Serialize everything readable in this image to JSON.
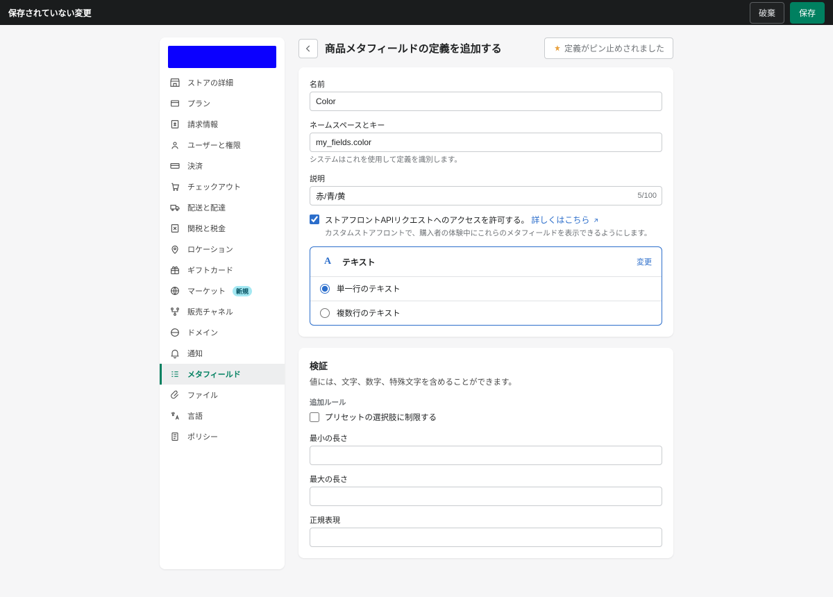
{
  "topbar": {
    "title": "保存されていない変更",
    "discard": "破棄",
    "save": "保存"
  },
  "sidebar": {
    "items": [
      {
        "label": "ストアの詳細"
      },
      {
        "label": "プラン"
      },
      {
        "label": "請求情報"
      },
      {
        "label": "ユーザーと権限"
      },
      {
        "label": "決済"
      },
      {
        "label": "チェックアウト"
      },
      {
        "label": "配送と配達"
      },
      {
        "label": "関税と税金"
      },
      {
        "label": "ロケーション"
      },
      {
        "label": "ギフトカード"
      },
      {
        "label": "マーケット",
        "badge": "新規"
      },
      {
        "label": "販売チャネル"
      },
      {
        "label": "ドメイン"
      },
      {
        "label": "通知"
      },
      {
        "label": "メタフィールド",
        "active": true
      },
      {
        "label": "ファイル"
      },
      {
        "label": "言語"
      },
      {
        "label": "ポリシー"
      }
    ]
  },
  "header": {
    "title": "商品メタフィールドの定義を追加する",
    "pin": "定義がピン止めされました"
  },
  "form": {
    "name_label": "名前",
    "name_value": "Color",
    "ns_label": "ネームスペースとキー",
    "ns_value": "my_fields.color",
    "ns_help": "システムはこれを使用して定義を識別します。",
    "desc_label": "説明",
    "desc_value": "赤/青/黄",
    "desc_counter": "5/100",
    "api_label": "ストアフロントAPIリクエストへのアクセスを許可する。",
    "api_link": "詳しくはこちら",
    "api_help": "カスタムストアフロントで、購入者の体験中にこれらのメタフィールドを表示できるようにします。",
    "type_name": "テキスト",
    "type_change": "変更",
    "radio_single": "単一行のテキスト",
    "radio_multi": "複数行のテキスト"
  },
  "validation": {
    "title": "検証",
    "desc": "値には、文字、数字、特殊文字を含めることができます。",
    "rules_label": "追加ルール",
    "preset_label": "プリセットの選択肢に制限する",
    "min_label": "最小の長さ",
    "max_label": "最大の長さ",
    "regex_label": "正規表現"
  }
}
